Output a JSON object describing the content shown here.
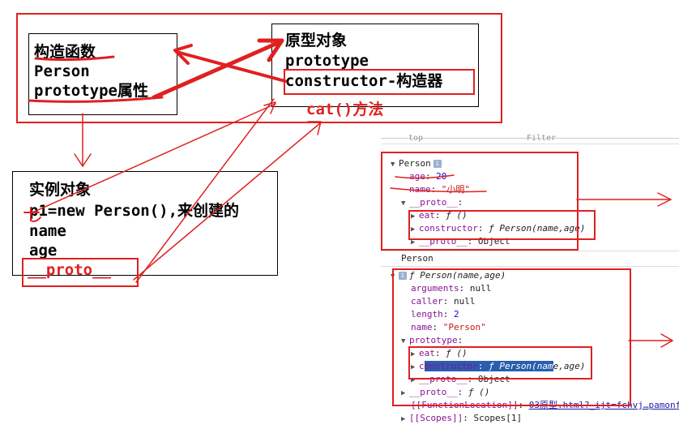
{
  "constructor_box": {
    "title": "构造函数",
    "name": "Person",
    "prop": "prototype属性"
  },
  "prototype_box": {
    "title": "原型对象",
    "prop": "prototype",
    "constructor": "constructor",
    "dash": "-",
    "constructor_note": "构造器",
    "method": "cat()方法"
  },
  "instance_box": {
    "title": "实例对象",
    "line1": "p1=new Person(),来创建的",
    "line2": "name",
    "line3": "age",
    "proto": "__proto__"
  },
  "devtools": {
    "top_fragment": "top",
    "filter_fragment": "Filter",
    "obj1": {
      "header": "Person",
      "age_key": "age",
      "age_val": "20",
      "name_key": "name",
      "name_val": "\"小明\"",
      "proto_key": "__proto__",
      "eat_key": "eat",
      "eat_val": "ƒ ()",
      "ctor_key": "constructor",
      "ctor_val": "ƒ Person(name,age)",
      "proto2_key": "__proto__",
      "proto2_val": "Object"
    },
    "obj2_label": "Person",
    "obj2": {
      "header": "ƒ Person(name,age)",
      "arguments_key": "arguments",
      "arguments_val": "null",
      "caller_key": "caller",
      "caller_val": "null",
      "length_key": "length",
      "length_val": "2",
      "name_key": "name",
      "name_val": "\"Person\"",
      "prototype_key": "prototype",
      "eat_key": "eat",
      "eat_val": "ƒ ()",
      "ctor_key_a": "c",
      "ctor_key_b": "onstructor",
      "ctor_sep": ":",
      "ctor_val_a": " ƒ Person(nam",
      "ctor_val_b": "e,age)",
      "proto3_key": "__proto__",
      "proto3_val": "Object",
      "proto4_key": "__proto__",
      "proto4_val": "ƒ ()",
      "funcloc_key": "[[FunctionLocation]]",
      "funcloc_val": "03原型.html?_ijt=fchvj…pamonf",
      "scopes_key": "[[Scopes]]",
      "scopes_val": "Scopes[1]"
    }
  },
  "colors": {
    "annotation_red": "#e02020"
  }
}
